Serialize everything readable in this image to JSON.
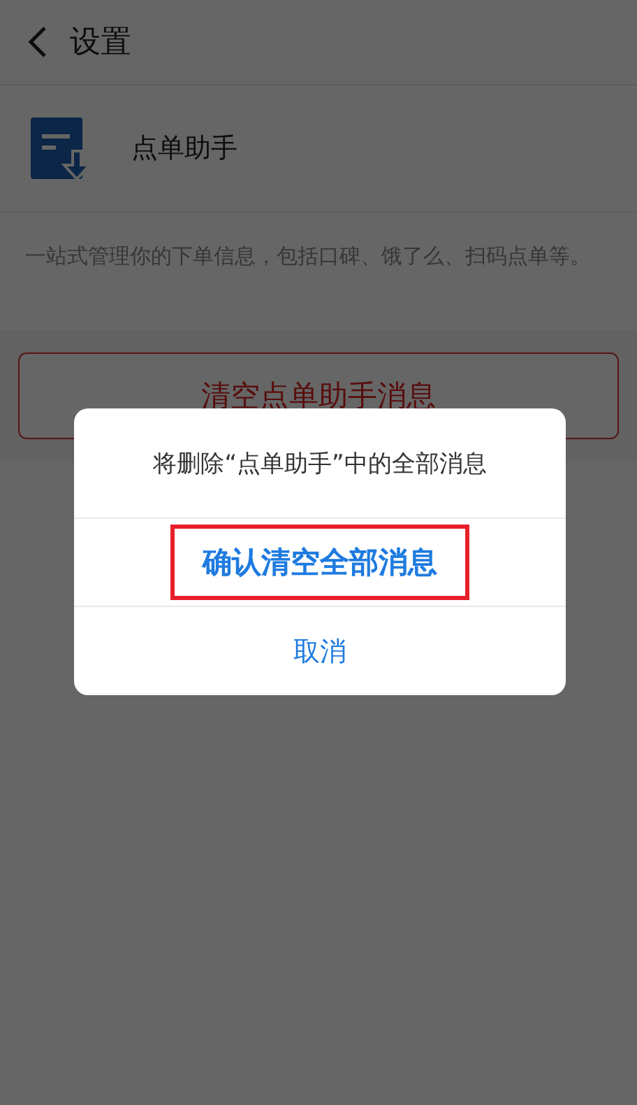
{
  "header": {
    "title": "设置"
  },
  "app": {
    "name": "点单助手",
    "description": "一站式管理你的下单信息，包括口碑、饿了么、扫码点单等。"
  },
  "clear_button": "清空点单助手消息",
  "dialog": {
    "message": "将删除“点单助手”中的全部消息",
    "actions": [
      {
        "label": "确认清空全部消息",
        "kind": "confirm",
        "highlighted": true
      },
      {
        "label": "取消",
        "kind": "cancel",
        "highlighted": false
      }
    ]
  }
}
